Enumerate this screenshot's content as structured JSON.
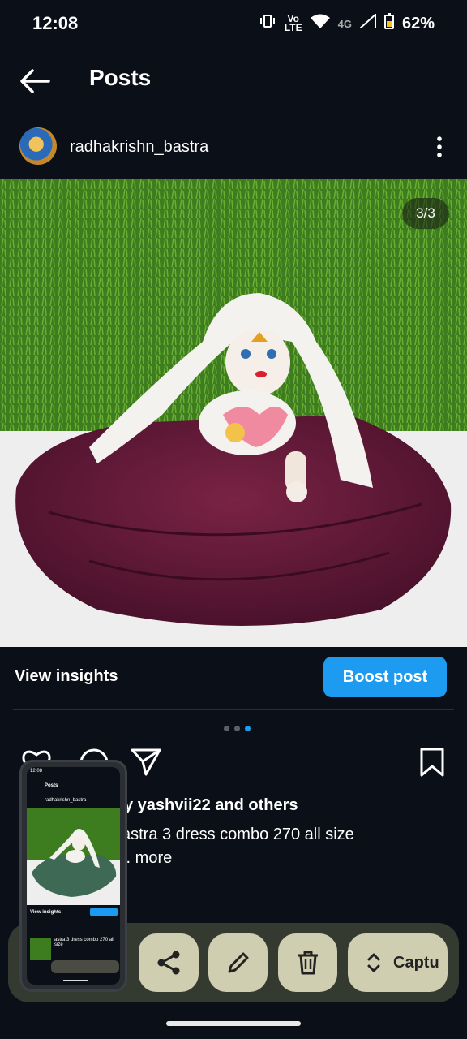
{
  "status_bar": {
    "time": "12:08",
    "network": "4G",
    "battery": "62%"
  },
  "header": {
    "title": "Posts"
  },
  "post": {
    "username": "radhakrishn_bastra",
    "image_counter": "3/3",
    "insights_label": "View insights",
    "boost_label": "Boost post",
    "carousel_index": 3,
    "carousel_total": 3,
    "likes_text": "y yashvii22 and others",
    "caption_text": "astra 3 dress combo 270 all size",
    "caption_more": ".. more"
  },
  "toolbar": {
    "capture_label": "Captu"
  },
  "colors": {
    "accent": "#1d9bf0",
    "background": "#0b0f17",
    "dress": "#5c1530",
    "grass": "#3e7d1f"
  }
}
